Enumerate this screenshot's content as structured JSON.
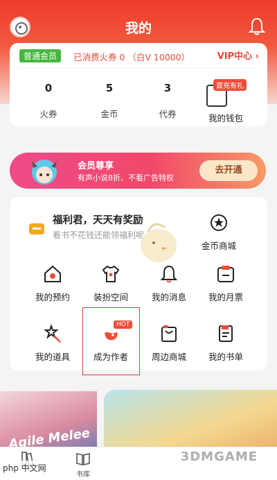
{
  "header": {
    "title": "我的"
  },
  "vip": {
    "badge": "普通会员",
    "consumed": "已消费火券 0 （白V 10000）",
    "center": "VIP中心 ›",
    "stats": [
      {
        "value": "0",
        "label": "火券"
      },
      {
        "value": "5",
        "label": "金币"
      },
      {
        "value": "3",
        "label": "代券"
      }
    ],
    "wallet_tag": "首充有礼",
    "wallet_label": "我的钱包"
  },
  "banner": {
    "title": "会员尊享",
    "subtitle": "有声小说8折、不看广告特权",
    "button": "去开通"
  },
  "welfare": {
    "title": "福利君，天天有奖励",
    "subtitle": "看书不花钱还能领福利呢"
  },
  "grid": {
    "coin_mall": "金币商城",
    "items": [
      {
        "label": "我的预约"
      },
      {
        "label": "装扮空间"
      },
      {
        "label": "我的消息"
      },
      {
        "label": "我的月票"
      },
      {
        "label": "我的道具"
      },
      {
        "label": "成为作者",
        "badge": "HOT"
      },
      {
        "label": "周边商城"
      },
      {
        "label": "我的书单"
      }
    ]
  },
  "art": {
    "left_text": "Agile Melee"
  },
  "tabbar": {
    "tabs": [
      {
        "label": ""
      },
      {
        "label": "书库"
      }
    ]
  },
  "watermark": {
    "left": "php 中文网",
    "right": "3DMGAME"
  }
}
